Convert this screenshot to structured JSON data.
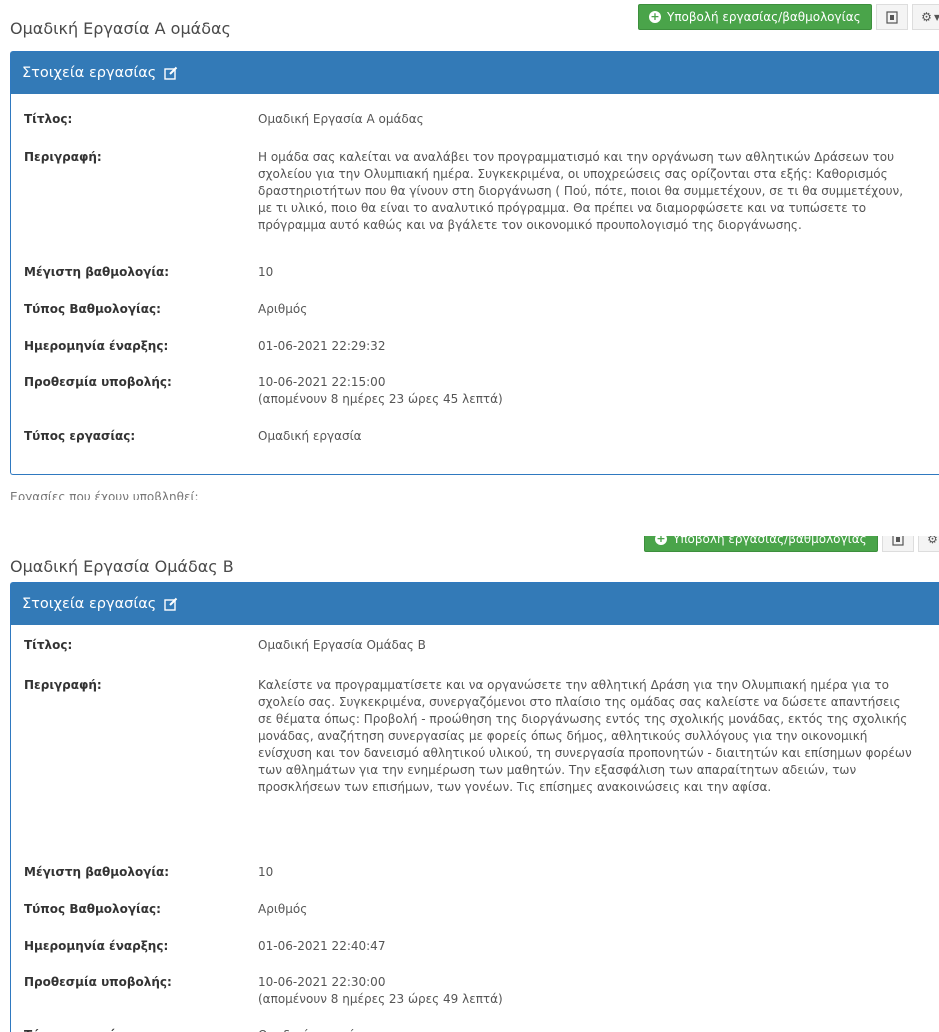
{
  "submit_label": "Υποβολή εργασίας/βαθμολογίας",
  "panel_heading": "Στοιχεία εργασίας",
  "labels": {
    "title": "Τίτλος:",
    "description": "Περιγραφή:",
    "max_grade": "Μέγιστη βαθμολογία:",
    "grade_type": "Τύπος Βαθμολογίας:",
    "start_date": "Ημερομηνία έναρξης:",
    "deadline": "Προθεσμία υποβολής:",
    "assignment_type": "Τύπος εργασίας:"
  },
  "assignment_a": {
    "page_title": "Ομαδική Εργασία Α ομάδας",
    "title": "Ομαδική Εργασία Α ομάδας",
    "description": "Η ομάδα σας καλείται να αναλάβει τον προγραμματισμό και την οργάνωση των αθλητικών Δράσεων του σχολείου για την Ολυμπιακή ημέρα. Συγκεκριμένα, οι υποχρεώσεις σας ορίζονται στα εξής: Καθορισμός δραστηριοτήτων που θα γίνουν στη διοργάνωση ( Πού, πότε, ποιοι θα συμμετέχουν, σε τι θα συμμετέχουν, με τι υλικό, ποιο θα είναι το αναλυτικό πρόγραμμα. Θα πρέπει να διαμορφώσετε και να τυπώσετε το πρόγραμμα αυτό καθώς και να βγάλετε τον οικονομικό προυπολογισμό της διοργάνωσης.",
    "max_grade": "10",
    "grade_type": "Αριθμός",
    "start_date": "01-06-2021 22:29:32",
    "deadline": "10-06-2021 22:15:00",
    "deadline_remaining": "(απομένουν 8 ημέρες 23 ώρες 45 λεπτά)",
    "assignment_type": "Ομαδική εργασία",
    "cut_text": "Εργασίες που έχουν υποβληθεί:"
  },
  "assignment_b": {
    "page_title": "Ομαδική Εργασία Ομάδας Β",
    "title": "Ομαδική Εργασία Ομάδας Β",
    "description": "Καλείστε να προγραμματίσετε και να οργανώσετε την αθλητική Δράση για την Ολυμπιακή ημέρα για το σχολείο σας. Συγκεκριμένα, συνεργαζόμενοι στο πλαίσιο της ομάδας σας καλείστε να δώσετε απαντήσεις σε θέματα όπως: Προβολή - προώθηση της διοργάνωσης εντός της σχολικής μονάδας, εκτός της σχολικής μονάδας, αναζήτηση συνεργασίας με φορείς όπως δήμος, αθλητικούς συλλόγους για την οικονομική ενίσχυση και τον δανεισμό αθλητικού υλικού, τη συνεργασία προπονητών - διαιτητών και επίσημων φορέων των αθλημάτων για την ενημέρωση των μαθητών. Την εξασφάλιση των απαραίτητων αδειών, των προσκλήσεων των επισήμων, των γονέων. Τις επίσημες ανακοινώσεις και την αφίσα.",
    "max_grade": "10",
    "grade_type": "Αριθμός",
    "start_date": "01-06-2021 22:40:47",
    "deadline": "10-06-2021 22:30:00",
    "deadline_remaining": "(απομένουν 8 ημέρες 23 ώρες 49 λεπτά)",
    "assignment_type": "Ομαδική εργασία"
  },
  "icons": {
    "submit": "plus-circle-icon",
    "export": "export-icon",
    "settings": "gear-icon",
    "edit": "edit-icon"
  },
  "colors": {
    "panel_header": "#337ab7",
    "submit_button": "#4aa44a"
  }
}
